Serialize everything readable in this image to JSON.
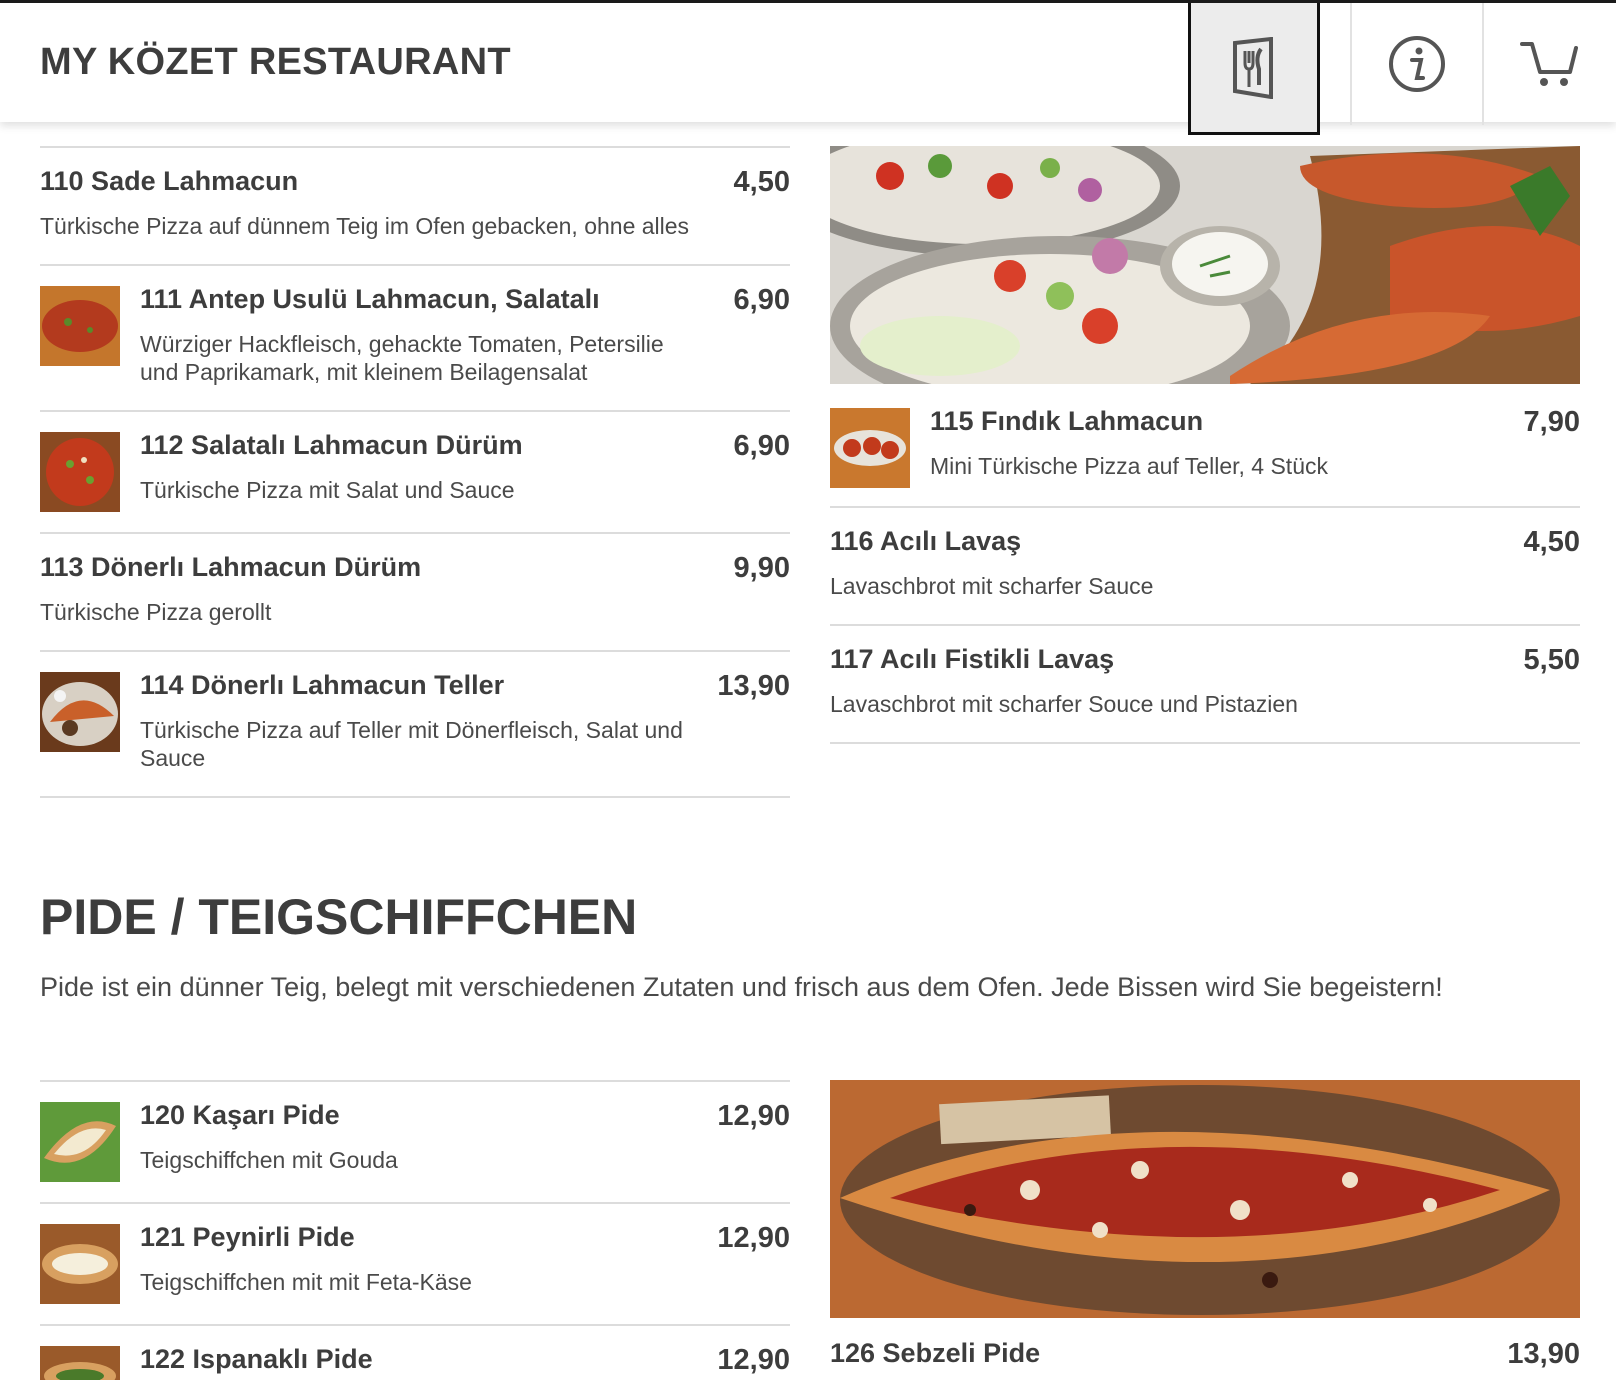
{
  "header": {
    "brand": "MY KÖZET RESTAURANT",
    "nav": [
      {
        "name": "menu",
        "icon": "fork-knife-icon",
        "active": true
      },
      {
        "name": "info",
        "icon": "info-icon",
        "active": false
      },
      {
        "name": "cart",
        "icon": "cart-icon",
        "active": false
      }
    ]
  },
  "lahmacun_left": [
    {
      "name": "110 Sade Lahmacun",
      "price": "4,50",
      "desc": "Türkische Pizza auf dünnem Teig im Ofen gebacken, ohne alles"
    },
    {
      "name": "111 Antep Usulü Lahmacun, Salatalı",
      "price": "6,90",
      "desc_l1": "Würziger Hackfleisch, gehackte Tomaten, Petersilie",
      "desc_l2": "und Paprikamark, mit kleinem Beilagensalat"
    },
    {
      "name": "112 Salatalı Lahmacun Dürüm",
      "price": "6,90",
      "desc": "Türkische Pizza mit Salat und Sauce"
    },
    {
      "name": "113 Dönerlı Lahmacun Dürüm",
      "price": "9,90",
      "desc": "Türkische Pizza gerollt"
    },
    {
      "name": "114 Dönerlı Lahmacun Teller",
      "price": "13,90",
      "desc_l1": "Türkische Pizza auf Teller mit Dönerfleisch, Salat und",
      "desc_l2": "Sauce"
    }
  ],
  "lahmacun_right": [
    {
      "name": "115 Fındık Lahmacun",
      "price": "7,90",
      "desc": "Mini Türkische Pizza auf Teller, 4 Stück"
    },
    {
      "name": "116 Acılı Lavaş",
      "price": "4,50",
      "desc": "Lavaschbrot mit scharfer Sauce"
    },
    {
      "name": "117 Acılı Fistikli Lavaş",
      "price": "5,50",
      "desc": "Lavaschbrot mit scharfer Souce und Pistazien"
    }
  ],
  "pide_section": {
    "title": "PIDE / TEIGSCHIFFCHEN",
    "desc": "Pide ist ein dünner Teig, belegt mit verschiedenen Zutaten und frisch aus dem Ofen. Jede Bissen wird Sie begeistern!"
  },
  "pide_left": [
    {
      "name": "120 Kaşarı Pide",
      "price": "12,90",
      "desc": "Teigschiffchen mit Gouda"
    },
    {
      "name": "121 Peynirli Pide",
      "price": "12,90",
      "desc": "Teigschiffchen mit mit Feta-Käse"
    },
    {
      "name": "122 Ispanaklı Pide",
      "price": "12,90"
    }
  ],
  "pide_right": [
    {
      "name": "126 Sebzeli Pide",
      "price": "13,90"
    }
  ]
}
